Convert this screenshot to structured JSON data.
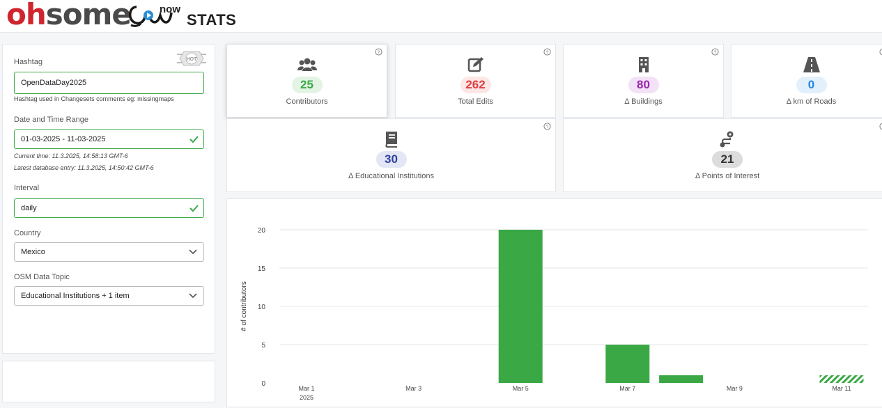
{
  "header": {
    "logo_oh": "oh",
    "logo_some": "some",
    "logo_now": "now",
    "logo_stats": "STATS"
  },
  "sidebar": {
    "hot_logo_text": "HOT",
    "hashtag": {
      "label": "Hashtag",
      "value": "OpenDataDay2025",
      "hint": "Hashtag used in Changesets comments eg: missingmaps"
    },
    "date_range": {
      "label": "Date and Time Range",
      "value": "01-03-2025 - 11-03-2025",
      "current_time": "Current time: 11.3.2025, 14:58:13 GMT-6",
      "latest_entry": "Latest database entry: 11.3.2025, 14:50:42 GMT-6"
    },
    "interval": {
      "label": "Interval",
      "value": "daily"
    },
    "country": {
      "label": "Country",
      "value": "Mexico"
    },
    "topic": {
      "label": "OSM Data Topic",
      "value": "Educational Institutions + 1 item"
    }
  },
  "cards": [
    {
      "value": "25",
      "label": "Contributors",
      "icon": "users-icon",
      "color": "#3aa845",
      "bg": "#e3f4e5"
    },
    {
      "value": "262",
      "label": "Total Edits",
      "icon": "edit-icon",
      "color": "#e03c3c",
      "bg": "#fde6e6"
    },
    {
      "value": "80",
      "label": "Δ Buildings",
      "icon": "building-icon",
      "color": "#9c27b0",
      "bg": "#f3e1f7"
    },
    {
      "value": "0",
      "label": "Δ km of Roads",
      "icon": "road-icon",
      "color": "#1e88e5",
      "bg": "#e2f0fc"
    },
    {
      "value": "30",
      "label": "Δ Educational Institutions",
      "icon": "book-icon",
      "color": "#2f3f9e",
      "bg": "#e3e6f5"
    },
    {
      "value": "21",
      "label": "Δ Points of Interest",
      "icon": "route-icon",
      "color": "#333333",
      "bg": "#dcdcdc"
    }
  ],
  "chart_data": {
    "type": "bar",
    "ylabel": "# of contributors",
    "xlabel": "",
    "ylim": [
      0,
      20
    ],
    "yticks": [
      0,
      5,
      10,
      15,
      20
    ],
    "xticks": [
      "Mar 1",
      "Mar 3",
      "Mar 5",
      "Mar 7",
      "Mar 9",
      "Mar 11"
    ],
    "xtick_sub": "2025",
    "categories": [
      "Mar 1",
      "Mar 2",
      "Mar 3",
      "Mar 4",
      "Mar 5",
      "Mar 6",
      "Mar 7",
      "Mar 8",
      "Mar 9",
      "Mar 10",
      "Mar 11"
    ],
    "values": [
      0,
      0,
      0,
      0,
      20,
      0,
      5,
      1,
      0,
      0,
      1
    ],
    "partial_last": true,
    "bar_color": "#3aa845",
    "grid": true
  }
}
